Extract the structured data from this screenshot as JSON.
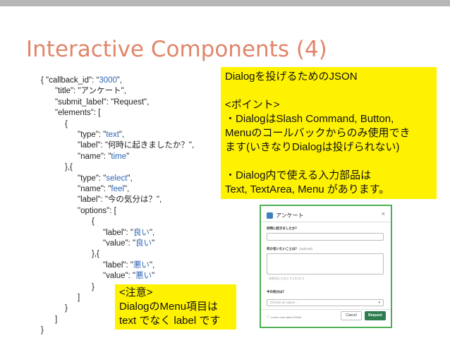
{
  "slide": {
    "title": "Interactive Components (4)"
  },
  "code_lines": [
    {
      "text": "{     \"callback_id\": “3000”,",
      "blue": "3000"
    },
    {
      "text": "\"title\": \"アンケート\",",
      "blue": ""
    },
    {
      "text": "\"submit_label\": \"Request\",",
      "blue": ""
    },
    {
      "text": "\"elements\": [",
      "blue": ""
    },
    {
      "text": "{",
      "blue": ""
    },
    {
      "text": "\"type\": \"text\",",
      "blue": "text"
    },
    {
      "text": "\"label\": \"何時に起きましたか？\",",
      "blue": ""
    },
    {
      "text": "\"name\": \"time\"",
      "blue": "time"
    },
    {
      "text": "},{",
      "blue": ""
    },
    {
      "text": "\"type\": \"select\",",
      "blue": "select"
    },
    {
      "text": "\"name\": \"feel\",",
      "blue": "feel"
    },
    {
      "text": "\"label\": \"今の気分は？\",",
      "blue": ""
    },
    {
      "text": "\"options\": [",
      "blue": ""
    },
    {
      "text": "{",
      "blue": ""
    },
    {
      "text": "\"label\": \"良い\",",
      "blue": "良い"
    },
    {
      "text": "\"value\": \"良い\"",
      "blue": "良い"
    },
    {
      "text": "},{",
      "blue": ""
    },
    {
      "text": "\"label\": \"悪い\",",
      "blue": "悪い"
    },
    {
      "text": "\"value\": \"悪い\"",
      "blue": "悪い"
    },
    {
      "text": "}",
      "blue": ""
    },
    {
      "text": "]",
      "blue": ""
    },
    {
      "text": "}",
      "blue": ""
    },
    {
      "text": "]",
      "blue": ""
    },
    {
      "text": "}",
      "blue": ""
    }
  ],
  "callout_json": {
    "lines": [
      "Dialogを投げるためのJSON",
      "",
      "<ポイント>",
      "・DialogはSlash Command, Button,",
      "Menuのコールバックからのみ使用でき",
      "ます(いきなりDialogは投げられない)",
      "",
      "・Dialog内で使える入力部品は",
      "Text, TextArea, Menu があります。"
    ]
  },
  "callout_note": {
    "lines": [
      "<注意>",
      "DialogのMenu項目は",
      "text でなく label です"
    ]
  },
  "dialog_preview": {
    "title": "アンケート",
    "close_glyph": "×",
    "field1_label": "何時に起きましたか？",
    "field2_label": "何か言いたいことは？",
    "field2_optional": "(optional)",
    "field2_hint": "（お好きに入力してください）",
    "field3_label": "今の気分は？",
    "select_placeholder": "Choose an option...",
    "footer_link": "Learn more about Dirbot",
    "cancel_label": "Cancel",
    "submit_label": "Request"
  },
  "colors": {
    "title": "#e0866a",
    "code_value": "#2e66b5",
    "callout_bg": "#fff200",
    "dialog_border": "#4caf50",
    "submit_bg": "#2e7d4f"
  }
}
